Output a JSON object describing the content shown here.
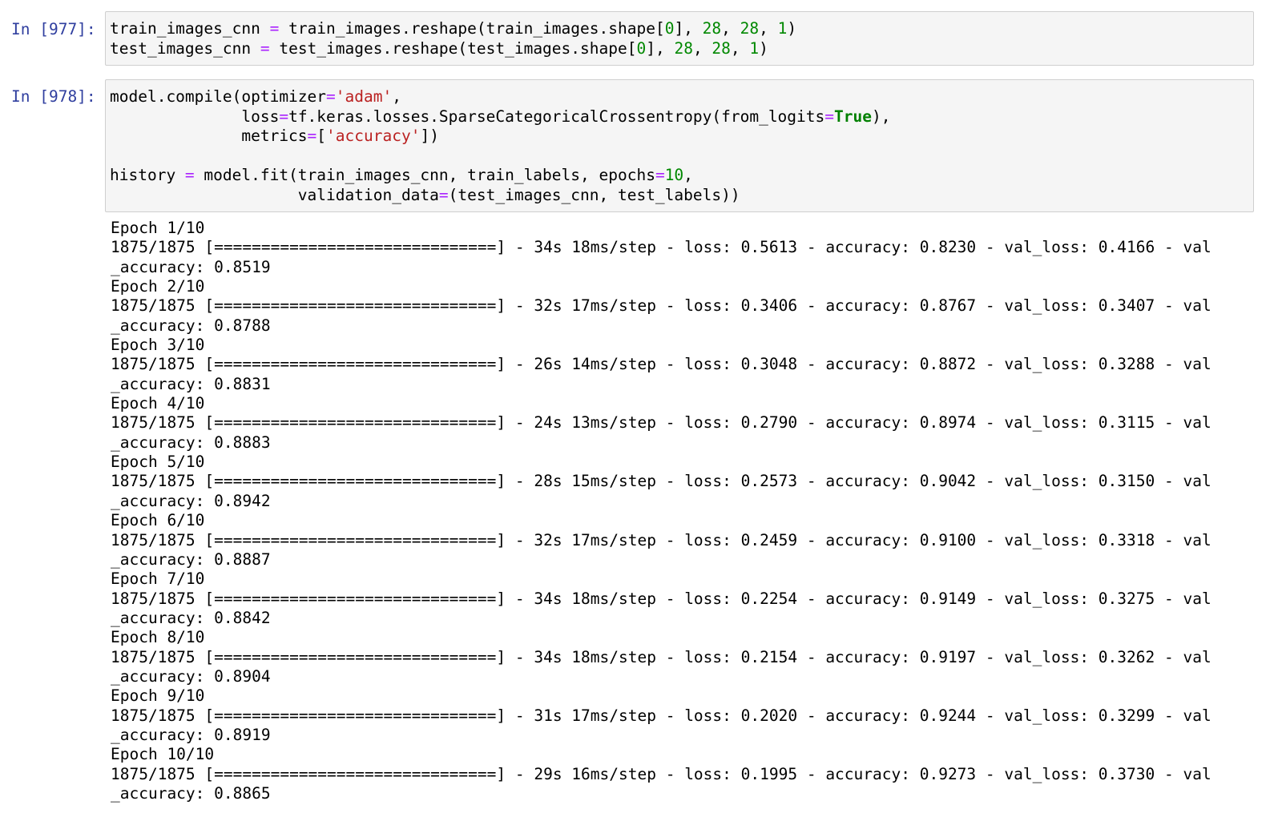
{
  "cells": [
    {
      "prompt": "In [977]:",
      "code_lines": [
        [
          {
            "t": "train_images_cnn "
          },
          {
            "t": "=",
            "c": "op"
          },
          {
            "t": " train_images.reshape(train_images.shape["
          },
          {
            "t": "0",
            "c": "num"
          },
          {
            "t": "], "
          },
          {
            "t": "28",
            "c": "num"
          },
          {
            "t": ", "
          },
          {
            "t": "28",
            "c": "num"
          },
          {
            "t": ", "
          },
          {
            "t": "1",
            "c": "num"
          },
          {
            "t": ")"
          }
        ],
        [
          {
            "t": "test_images_cnn "
          },
          {
            "t": "=",
            "c": "op"
          },
          {
            "t": " test_images.reshape(test_images.shape["
          },
          {
            "t": "0",
            "c": "num"
          },
          {
            "t": "], "
          },
          {
            "t": "28",
            "c": "num"
          },
          {
            "t": ", "
          },
          {
            "t": "28",
            "c": "num"
          },
          {
            "t": ", "
          },
          {
            "t": "1",
            "c": "num"
          },
          {
            "t": ")"
          }
        ]
      ]
    },
    {
      "prompt": "In [978]:",
      "code_lines": [
        [
          {
            "t": "model.compile(optimizer"
          },
          {
            "t": "=",
            "c": "op"
          },
          {
            "t": "'adam'",
            "c": "str"
          },
          {
            "t": ","
          }
        ],
        [
          {
            "t": "              loss"
          },
          {
            "t": "=",
            "c": "op"
          },
          {
            "t": "tf.keras.losses.SparseCategoricalCrossentropy(from_logits"
          },
          {
            "t": "=",
            "c": "op"
          },
          {
            "t": "True",
            "c": "kw"
          },
          {
            "t": "),"
          }
        ],
        [
          {
            "t": "              metrics"
          },
          {
            "t": "=",
            "c": "op"
          },
          {
            "t": "["
          },
          {
            "t": "'accuracy'",
            "c": "str"
          },
          {
            "t": "])"
          }
        ],
        [
          {
            "t": ""
          }
        ],
        [
          {
            "t": "history "
          },
          {
            "t": "=",
            "c": "op"
          },
          {
            "t": " model.fit(train_images_cnn, train_labels, epochs"
          },
          {
            "t": "=",
            "c": "op"
          },
          {
            "t": "10",
            "c": "num"
          },
          {
            "t": ","
          }
        ],
        [
          {
            "t": "                    validation_data"
          },
          {
            "t": "=",
            "c": "op"
          },
          {
            "t": "(test_images_cnn, test_labels))"
          }
        ]
      ]
    }
  ],
  "output": {
    "progress_bar": "[==============================]",
    "epochs": [
      {
        "epoch": "Epoch 1/10",
        "steps": "1875/1875",
        "time": "34s 18ms/step",
        "loss": "0.5613",
        "accuracy": "0.8230",
        "val_loss": "0.4166",
        "val_accuracy": "0.8519"
      },
      {
        "epoch": "Epoch 2/10",
        "steps": "1875/1875",
        "time": "32s 17ms/step",
        "loss": "0.3406",
        "accuracy": "0.8767",
        "val_loss": "0.3407",
        "val_accuracy": "0.8788"
      },
      {
        "epoch": "Epoch 3/10",
        "steps": "1875/1875",
        "time": "26s 14ms/step",
        "loss": "0.3048",
        "accuracy": "0.8872",
        "val_loss": "0.3288",
        "val_accuracy": "0.8831"
      },
      {
        "epoch": "Epoch 4/10",
        "steps": "1875/1875",
        "time": "24s 13ms/step",
        "loss": "0.2790",
        "accuracy": "0.8974",
        "val_loss": "0.3115",
        "val_accuracy": "0.8883"
      },
      {
        "epoch": "Epoch 5/10",
        "steps": "1875/1875",
        "time": "28s 15ms/step",
        "loss": "0.2573",
        "accuracy": "0.9042",
        "val_loss": "0.3150",
        "val_accuracy": "0.8942"
      },
      {
        "epoch": "Epoch 6/10",
        "steps": "1875/1875",
        "time": "32s 17ms/step",
        "loss": "0.2459",
        "accuracy": "0.9100",
        "val_loss": "0.3318",
        "val_accuracy": "0.8887"
      },
      {
        "epoch": "Epoch 7/10",
        "steps": "1875/1875",
        "time": "34s 18ms/step",
        "loss": "0.2254",
        "accuracy": "0.9149",
        "val_loss": "0.3275",
        "val_accuracy": "0.8842"
      },
      {
        "epoch": "Epoch 8/10",
        "steps": "1875/1875",
        "time": "34s 18ms/step",
        "loss": "0.2154",
        "accuracy": "0.9197",
        "val_loss": "0.3262",
        "val_accuracy": "0.8904"
      },
      {
        "epoch": "Epoch 9/10",
        "steps": "1875/1875",
        "time": "31s 17ms/step",
        "loss": "0.2020",
        "accuracy": "0.9244",
        "val_loss": "0.3299",
        "val_accuracy": "0.8919"
      },
      {
        "epoch": "Epoch 10/10",
        "steps": "1875/1875",
        "time": "29s 16ms/step",
        "loss": "0.1995",
        "accuracy": "0.9273",
        "val_loss": "0.3730",
        "val_accuracy": "0.8865"
      }
    ]
  },
  "colors": {
    "prompt": "#303f9f",
    "operator": "#aa22ff",
    "number": "#008800",
    "string": "#ba2121",
    "keyword": "#008000",
    "input_bg": "#f5f5f5",
    "input_border": "#cfcfcf"
  }
}
